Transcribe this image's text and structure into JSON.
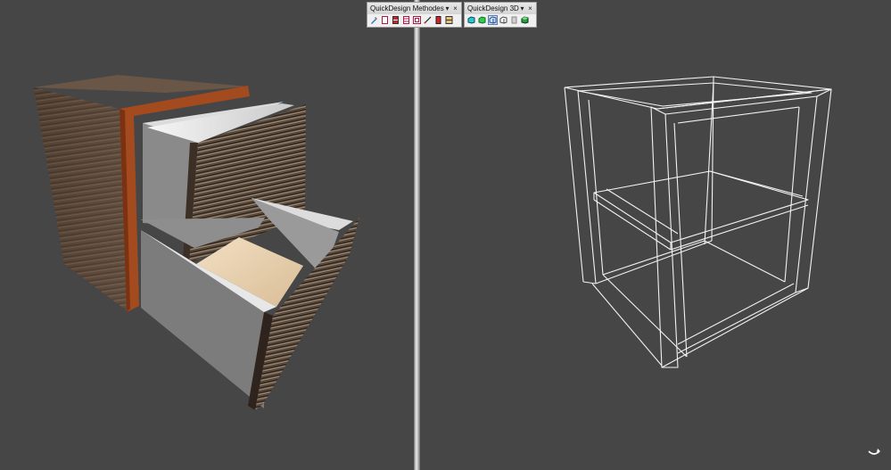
{
  "toolbars": {
    "methods": {
      "title": "QuickDesign Methodes",
      "menu_glyph": "▾",
      "close_glyph": "×",
      "buttons": [
        {
          "icon": "wrench-pencil-icon"
        },
        {
          "icon": "single-panel-icon"
        },
        {
          "icon": "two-drawer-icon"
        },
        {
          "icon": "three-shelf-icon"
        },
        {
          "icon": "framed-box-icon"
        },
        {
          "icon": "draw-line-icon"
        },
        {
          "icon": "red-door-icon"
        },
        {
          "icon": "cabinet-icon"
        }
      ]
    },
    "view3d": {
      "title": "QuickDesign 3D",
      "menu_glyph": "▾",
      "close_glyph": "×",
      "buttons": [
        {
          "icon": "solid-cyan-box-icon"
        },
        {
          "icon": "solid-green-box-icon"
        },
        {
          "icon": "wire-box-icon",
          "active": true
        },
        {
          "icon": "hidden-line-box-icon"
        },
        {
          "icon": "grey-panel-icon"
        },
        {
          "icon": "green-shaded-box-icon"
        }
      ]
    }
  },
  "viewports": {
    "left": {
      "mode": "shaded",
      "object": "drawer-cabinet"
    },
    "right": {
      "mode": "wireframe",
      "object": "cabinet-frame"
    }
  },
  "colors": {
    "viewport_bg": "#464646",
    "wood_dark": "#5e4a3c",
    "wood_edge": "#a34a1f",
    "drawer_front": "#6b5d52",
    "drawer_inner": "#8d8d8d",
    "drawer_floor": "#e9d3b4",
    "wire": "#f2f2f2"
  }
}
